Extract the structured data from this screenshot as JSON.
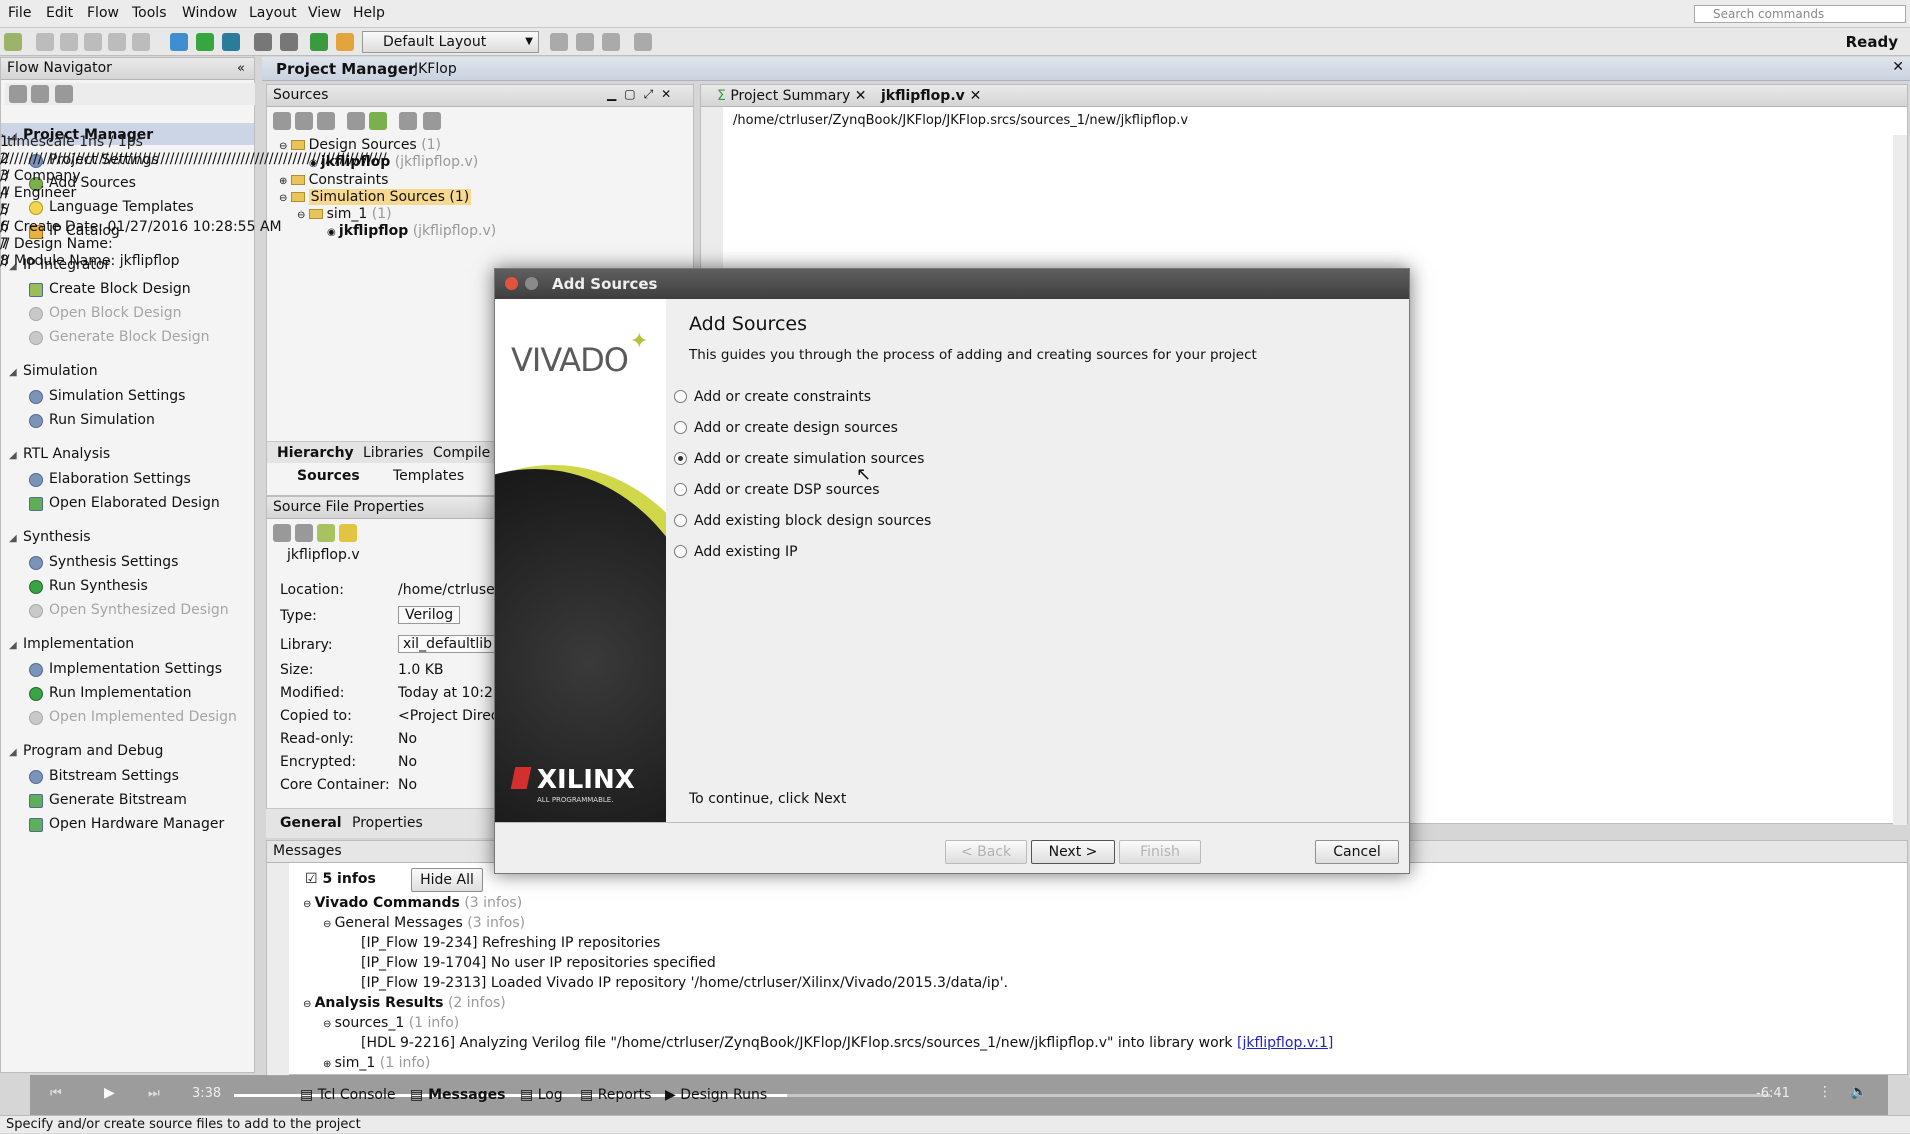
{
  "menu": [
    "File",
    "Edit",
    "Flow",
    "Tools",
    "Window",
    "Layout",
    "View",
    "Help"
  ],
  "search_placeholder": "Search commands",
  "layout_select": "Default Layout",
  "status_ready": "Ready",
  "flow_nav": {
    "title": "Flow Navigator",
    "sections": [
      {
        "label": "Project Manager",
        "items": [
          {
            "label": "Project Settings",
            "disabled": false
          },
          {
            "label": "Add Sources",
            "disabled": false
          },
          {
            "label": "Language Templates",
            "disabled": false
          },
          {
            "label": "IP Catalog",
            "disabled": false
          }
        ]
      },
      {
        "label": "IP Integrator",
        "items": [
          {
            "label": "Create Block Design",
            "disabled": false
          },
          {
            "label": "Open Block Design",
            "disabled": true
          },
          {
            "label": "Generate Block Design",
            "disabled": true
          }
        ]
      },
      {
        "label": "Simulation",
        "items": [
          {
            "label": "Simulation Settings",
            "disabled": false
          },
          {
            "label": "Run Simulation",
            "disabled": false
          }
        ]
      },
      {
        "label": "RTL Analysis",
        "items": [
          {
            "label": "Elaboration Settings",
            "disabled": false
          },
          {
            "label": "Open Elaborated Design",
            "disabled": false
          }
        ]
      },
      {
        "label": "Synthesis",
        "items": [
          {
            "label": "Synthesis Settings",
            "disabled": false
          },
          {
            "label": "Run Synthesis",
            "disabled": false
          },
          {
            "label": "Open Synthesized Design",
            "disabled": true
          }
        ]
      },
      {
        "label": "Implementation",
        "items": [
          {
            "label": "Implementation Settings",
            "disabled": false
          },
          {
            "label": "Run Implementation",
            "disabled": false
          },
          {
            "label": "Open Implemented Design",
            "disabled": true
          }
        ]
      },
      {
        "label": "Program and Debug",
        "items": [
          {
            "label": "Bitstream Settings",
            "disabled": false
          },
          {
            "label": "Generate Bitstream",
            "disabled": false
          },
          {
            "label": "Open Hardware Manager",
            "disabled": false
          }
        ]
      }
    ]
  },
  "pm": {
    "title": "Project Manager",
    "project": "JKFlop"
  },
  "sources": {
    "title": "Sources",
    "tree": {
      "design_sources": "Design Sources",
      "design_count": "(1)",
      "jk1": "jkflipflop",
      "jk1_file": "(jkflipflop.v)",
      "constraints": "Constraints",
      "sim_sources": "Simulation Sources (1)",
      "sim_1": "sim_1",
      "sim_1_count": "(1)",
      "jk2": "jkflipflop",
      "jk2_file": "(jkflipflop.v)"
    },
    "tabs": [
      "Hierarchy",
      "Libraries",
      "Compile O"
    ],
    "subtabs": [
      "Sources",
      "Templates"
    ]
  },
  "sfp": {
    "title": "Source File Properties",
    "file": "jkflipflop.v",
    "location_k": "Location:",
    "location_v": "/home/ctrluser",
    "type_k": "Type:",
    "type_v": "Verilog",
    "library_k": "Library:",
    "library_v": "xil_defaultlib",
    "size_k": "Size:",
    "size_v": "1.0 KB",
    "modified_k": "Modified:",
    "modified_v": "Today at 10:2",
    "copied_k": "Copied to:",
    "copied_v": "<Project Direc",
    "readonly_k": "Read-only:",
    "readonly_v": "No",
    "encrypted_k": "Encrypted:",
    "encrypted_v": "No",
    "core_k": "Core Container:",
    "core_v": "No",
    "tabs": [
      "General",
      "Properties"
    ]
  },
  "editor": {
    "tabs": [
      "Project Summary",
      "jkflipflop.v"
    ],
    "path": "/home/ctrluser/ZynqBook/JKFlop/JKFlop.srcs/sources_1/new/jkflipflop.v",
    "lines": [
      {
        "n": "1",
        "t": "`timescale 1ns / 1ps"
      },
      {
        "n": "2",
        "t": "//////////////////////////////////////////////////////////////////////////////////"
      },
      {
        "n": "3",
        "t": "// Company"
      },
      {
        "n": "4",
        "t": "// Engineer"
      },
      {
        "n": "5",
        "t": "//"
      },
      {
        "n": "6",
        "t": "// Create Date: 01/27/2016 10:28:55 AM"
      },
      {
        "n": "7",
        "t": "// Design Name:"
      },
      {
        "n": "8",
        "t": "// Module Name: jkflipflop"
      }
    ]
  },
  "messages": {
    "title": "Messages",
    "infos": "5 infos",
    "hide_all": "Hide All",
    "rows": {
      "vc": "Vivado Commands",
      "vc_count": "(3 infos)",
      "gm": "General Messages",
      "gm_count": "(3 infos)",
      "m1": "[IP_Flow 19-234] Refreshing IP repositories",
      "m2": "[IP_Flow 19-1704] No user IP repositories specified",
      "m3": "[IP_Flow 19-2313] Loaded Vivado IP repository '/home/ctrluser/Xilinx/Vivado/2015.3/data/ip'.",
      "ar": "Analysis Results",
      "ar_count": "(2 infos)",
      "s1": "sources_1",
      "s1_count": "(1 info)",
      "m4": "[HDL 9-2216] Analyzing Verilog file \"/home/ctrluser/ZynqBook/JKFlop/JKFlop.srcs/sources_1/new/jkflipflop.v\" into library work",
      "m4_link": "[jkflipflop.v:1]",
      "sim": "sim_1",
      "sim_count": "(1 info)"
    },
    "bottom_tabs": [
      "Tcl Console",
      "Messages",
      "Log",
      "Reports",
      "Design Runs"
    ]
  },
  "dialog": {
    "title": "Add Sources",
    "heading": "Add Sources",
    "desc": "This guides you through the process of adding and creating sources for your project",
    "options": [
      "Add or create constraints",
      "Add or create design sources",
      "Add or create simulation sources",
      "Add or create DSP sources",
      "Add existing block design sources",
      "Add existing IP"
    ],
    "selected": 2,
    "continue": "To continue, click Next",
    "back": "< Back",
    "next": "Next >",
    "finish": "Finish",
    "cancel": "Cancel",
    "vivado": "VIVADO",
    "xilinx": "XILINX",
    "xilinx_sub": "ALL PROGRAMMABLE."
  },
  "video": {
    "elapsed": "3:38",
    "remaining": "-6:41",
    "progress": 0.36
  },
  "statusbar": "Specify and/or create source files to add to the project",
  "colors": {
    "selection": "#f6d98e",
    "dialog_title": "#4a4a4a",
    "link": "#2222cc"
  }
}
